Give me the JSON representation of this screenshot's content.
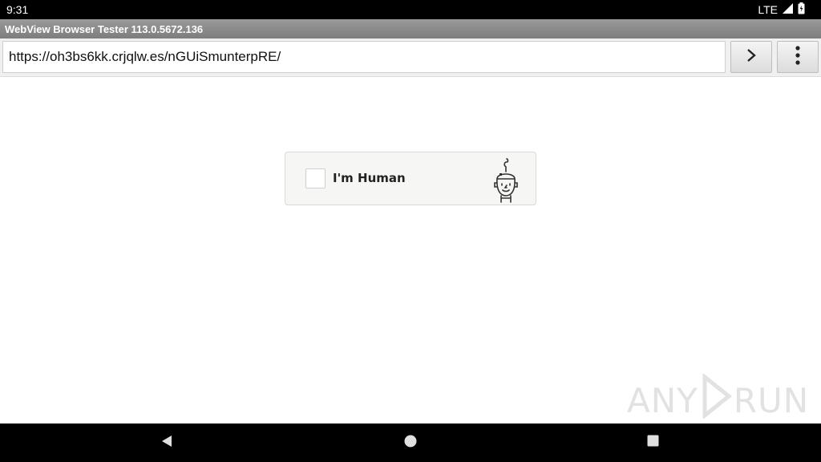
{
  "status_bar": {
    "time": "9:31",
    "network": "LTE",
    "signal_icon": "signal-icon",
    "battery_icon": "battery-icon"
  },
  "title_bar": {
    "title": "WebView Browser Tester 113.0.5672.136"
  },
  "address_bar": {
    "url": "https://oh3bs6kk.crjqlw.es/nGUiSmunterpRE/",
    "go_icon": "chevron-right-icon",
    "menu_icon": "more-vert-icon"
  },
  "captcha": {
    "checked": false,
    "label": "I'm Human",
    "logo_icon": "robot-icon"
  },
  "watermark": {
    "left_text": "ANY",
    "right_text": "RUN",
    "icon": "play-icon"
  },
  "nav_bar": {
    "back_icon": "back-triangle-icon",
    "home_icon": "home-circle-icon",
    "recents_icon": "recents-square-icon"
  },
  "colors": {
    "status_bar_bg": "#000000",
    "title_bar_bg": "#8a8a8a",
    "captcha_bg": "#f6f6f4",
    "nav_bar_bg": "#000000"
  }
}
